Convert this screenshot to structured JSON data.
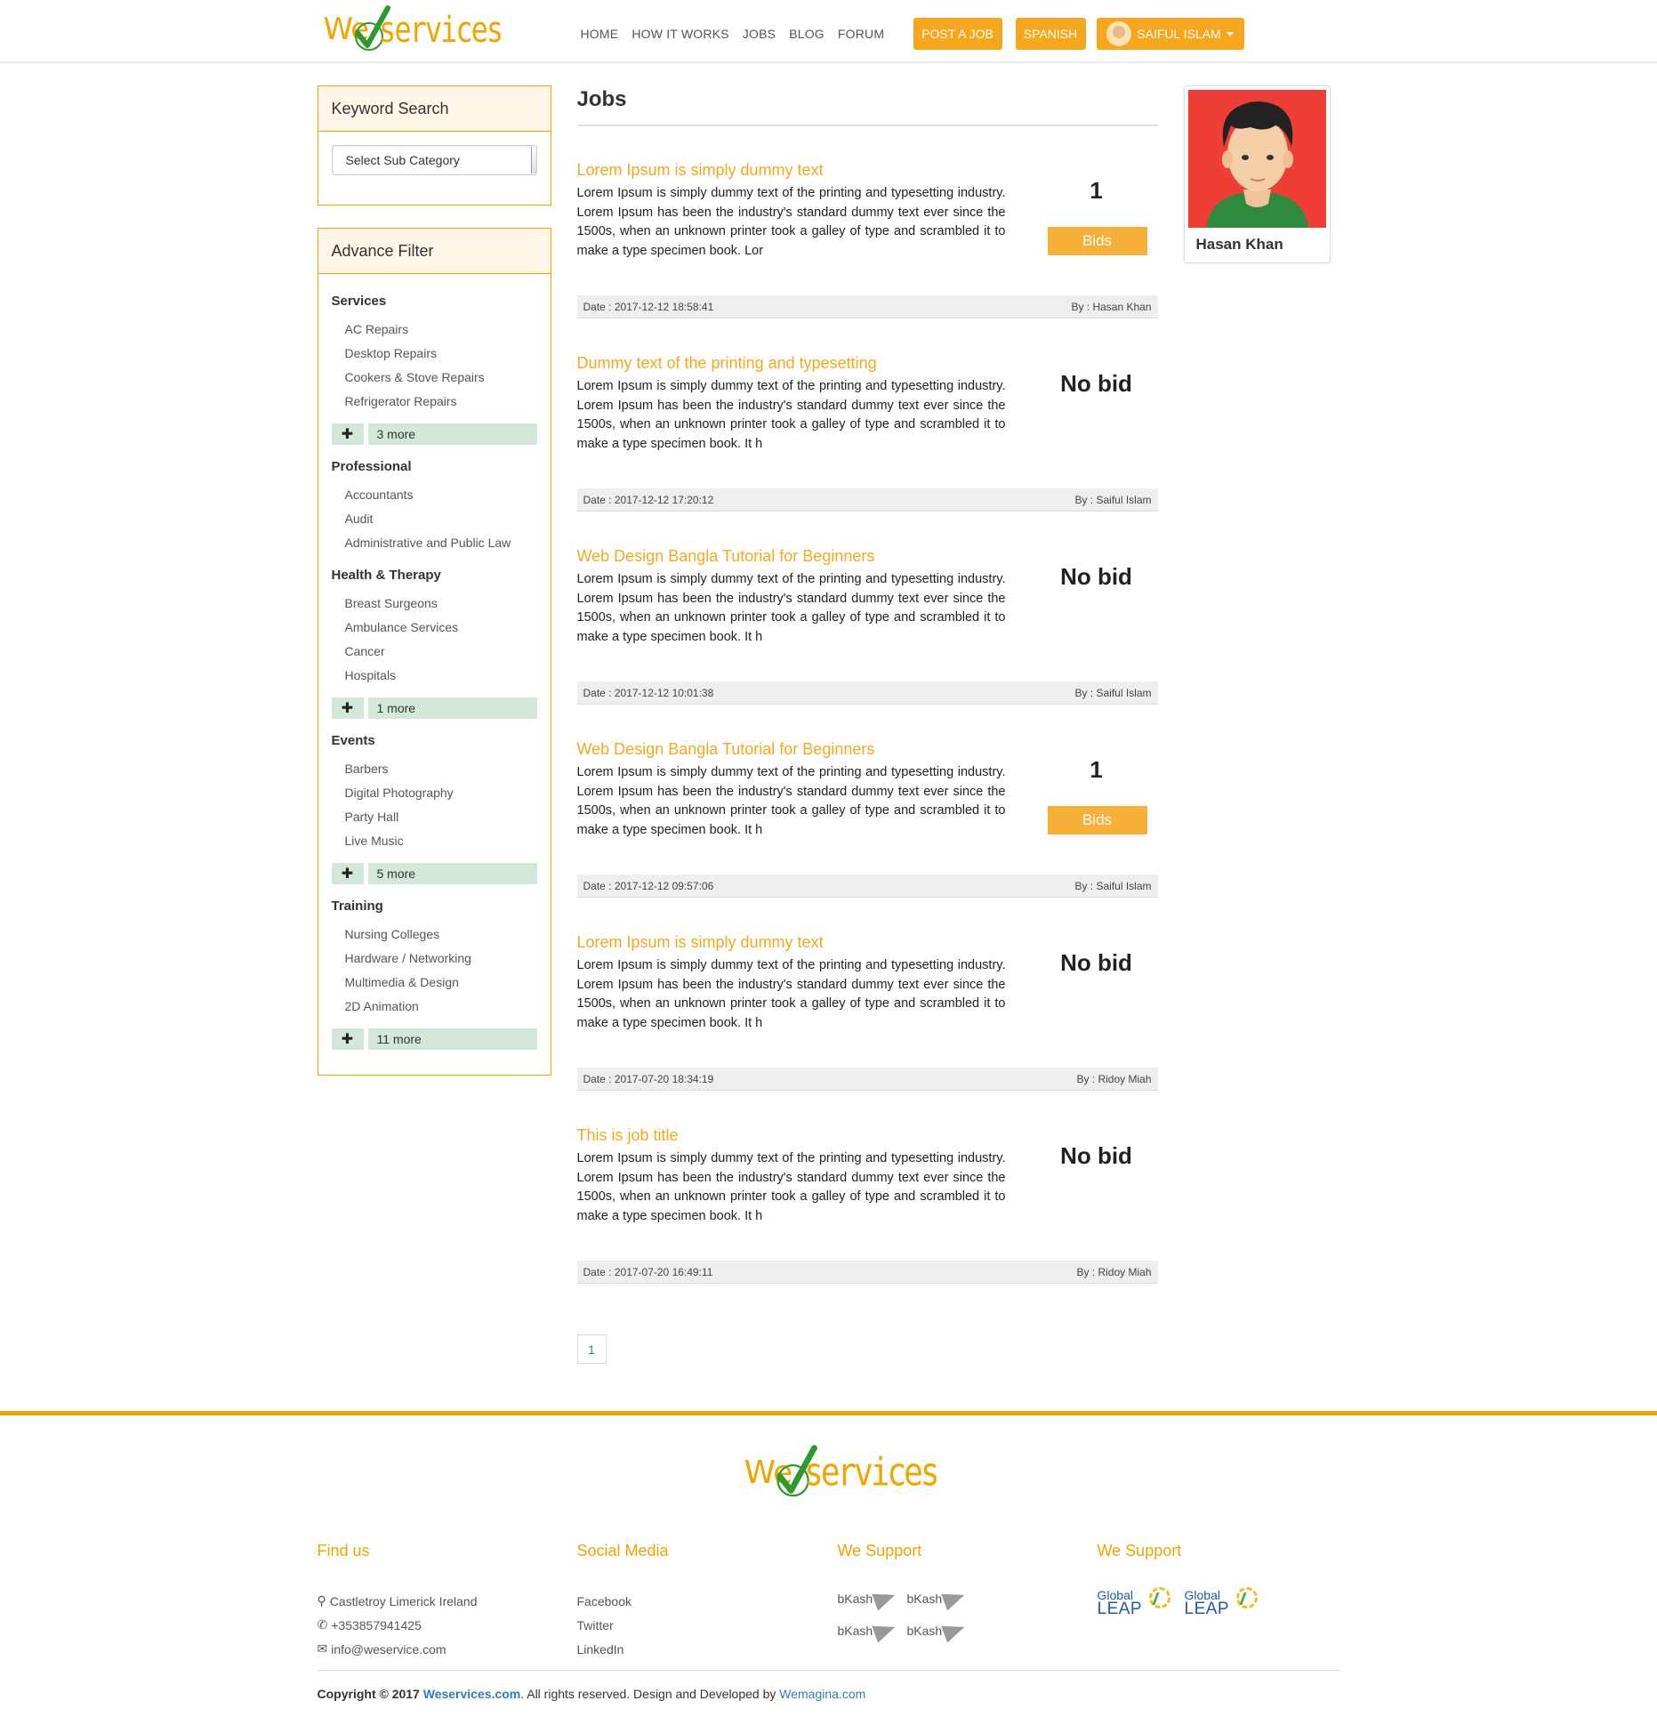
{
  "header": {
    "logo_we": "We",
    "logo_services": "services",
    "nav": [
      "HOME",
      "HOW IT WORKS",
      "JOBS",
      "BLOG",
      "FORUM"
    ],
    "post_job": "POST A JOB",
    "language": "SPANISH",
    "user_name": "SAIFUL ISLAM"
  },
  "sidebar": {
    "keyword_title": "Keyword Search",
    "select_placeholder": "Select Sub Category",
    "filter_title": "Advance Filter",
    "categories": [
      {
        "title": "Services",
        "items": [
          "AC Repairs",
          "Desktop Repairs",
          "Cookers & Stove Repairs",
          "Refrigerator Repairs"
        ],
        "more": "3 more"
      },
      {
        "title": "Professional",
        "items": [
          "Accountants",
          "Audit",
          "Administrative and Public Law"
        ],
        "more": ""
      },
      {
        "title": "Health & Therapy",
        "items": [
          "Breast Surgeons",
          "Ambulance Services",
          "Cancer",
          "Hospitals"
        ],
        "more": "1 more"
      },
      {
        "title": "Events",
        "items": [
          "Barbers",
          "Digital Photography",
          "Party Hall",
          "Live Music"
        ],
        "more": "5 more"
      },
      {
        "title": "Training",
        "items": [
          "Nursing Colleges",
          "Hardware / Networking",
          "Multimedia & Design",
          "2D Animation"
        ],
        "more": "11 more"
      }
    ]
  },
  "content": {
    "page_title": "Jobs",
    "bids_label": "Bids",
    "no_bid_label": "No bid",
    "jobs": [
      {
        "title": "Lorem Ipsum is simply dummy text",
        "desc": "Lorem Ipsum is simply dummy text of the printing and typesetting industry. Lorem Ipsum has been the industry's standard dummy text ever since the 1500s, when an unknown printer took a galley of type and scrambled it to make a type specimen book. Lor",
        "bids": "1",
        "date": "Date : 2017-12-12 18:58:41",
        "by": "By : Hasan Khan"
      },
      {
        "title": "Dummy text of the printing and typesetting",
        "desc": "Lorem Ipsum is simply dummy text of the printing and typesetting industry. Lorem Ipsum has been the industry's standard dummy text ever since the 1500s, when an unknown printer took a galley of type and scrambled it to make a type specimen book. It h",
        "bids": "",
        "date": "Date : 2017-12-12 17:20:12",
        "by": "By : Saiful Islam"
      },
      {
        "title": "Web Design Bangla Tutorial for Beginners",
        "desc": "Lorem Ipsum is simply dummy text of the printing and typesetting industry. Lorem Ipsum has been the industry's standard dummy text ever since the 1500s, when an unknown printer took a galley of type and scrambled it to make a type specimen book. It h",
        "bids": "",
        "date": "Date : 2017-12-12 10:01:38",
        "by": "By : Saiful Islam"
      },
      {
        "title": "Web Design Bangla Tutorial for Beginners",
        "desc": "Lorem Ipsum is simply dummy text of the printing and typesetting industry. Lorem Ipsum has been the industry's standard dummy text ever since the 1500s, when an unknown printer took a galley of type and scrambled it to make a type specimen book. It h",
        "bids": "1",
        "date": "Date : 2017-12-12 09:57:06",
        "by": "By : Saiful Islam"
      },
      {
        "title": "Lorem Ipsum is simply dummy text",
        "desc": "Lorem Ipsum is simply dummy text of the printing and typesetting industry. Lorem Ipsum has been the industry's standard dummy text ever since the 1500s, when an unknown printer took a galley of type and scrambled it to make a type specimen book. It h",
        "bids": "",
        "date": "Date : 2017-07-20 18:34:19",
        "by": "By : Ridoy Miah"
      },
      {
        "title": "This is job title",
        "desc": "Lorem Ipsum is simply dummy text of the printing and typesetting industry. Lorem Ipsum has been the industry's standard dummy text ever since the 1500s, when an unknown printer took a galley of type and scrambled it to make a type specimen book. It h",
        "bids": "",
        "date": "Date : 2017-07-20 16:49:11",
        "by": "By : Ridoy Miah"
      }
    ],
    "page_number": "1"
  },
  "profile": {
    "name": "Hasan Khan"
  },
  "footer": {
    "find_us_title": "Find us",
    "address": "Castletroy Limerick Ireland",
    "phone": "+353857941425",
    "email": "info@weservice.com",
    "social_title": "Social Media",
    "social": [
      "Facebook",
      "Twitter",
      "LinkedIn"
    ],
    "support_title_1": "We Support",
    "support_title_2": "We Support",
    "bkash_label": "bKash",
    "leap_global": "Global",
    "leap_word": "LEAP",
    "copyright_prefix": "Copyright © 2017 ",
    "copyright_site": "Weservices.com",
    "copyright_mid": ". All rights reserved. Design and Developed by ",
    "copyright_dev": "Wemagina.com"
  },
  "colors": {
    "accent": "#f7a71d",
    "more_bg": "#d4e8d9",
    "profile_bg": "#ef3e36",
    "link_blue": "#337ab7"
  }
}
